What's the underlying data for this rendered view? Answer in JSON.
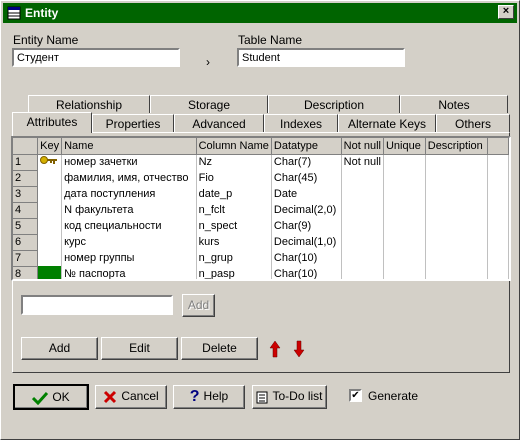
{
  "window": {
    "title": "Entity",
    "close_glyph": "×"
  },
  "entity_name": {
    "label": "Entity Name",
    "value": "Студент"
  },
  "table_name": {
    "label": "Table Name",
    "value": "Student"
  },
  "arrow_glyph": "›",
  "tabs_row1": [
    "Relationship",
    "Storage",
    "Description",
    "Notes"
  ],
  "tabs_row2": [
    "Attributes",
    "Properties",
    "Advanced",
    "Indexes",
    "Alternate Keys",
    "Others"
  ],
  "grid": {
    "headers": [
      "Key",
      "Name",
      "Column Name",
      "Datatype",
      "Not null",
      "Unique",
      "Description"
    ],
    "rows": [
      {
        "num": "1",
        "name": "номер зачетки",
        "column": "Nz",
        "datatype": "Char(7)",
        "notnull": "Not null",
        "unique": "",
        "desc": ""
      },
      {
        "num": "2",
        "name": "фамилия, имя, отчество",
        "column": "Fio",
        "datatype": "Char(45)",
        "notnull": "",
        "unique": "",
        "desc": ""
      },
      {
        "num": "3",
        "name": "дата поступления",
        "column": "date_p",
        "datatype": "Date",
        "notnull": "",
        "unique": "",
        "desc": ""
      },
      {
        "num": "4",
        "name": "N факультета",
        "column": "n_fclt",
        "datatype": "Decimal(2,0)",
        "notnull": "",
        "unique": "",
        "desc": ""
      },
      {
        "num": "5",
        "name": "код специальности",
        "column": "n_spect",
        "datatype": "Char(9)",
        "notnull": "",
        "unique": "",
        "desc": ""
      },
      {
        "num": "6",
        "name": "курс",
        "column": "kurs",
        "datatype": "Decimal(1,0)",
        "notnull": "",
        "unique": "",
        "desc": ""
      },
      {
        "num": "7",
        "name": "номер группы",
        "column": "n_grup",
        "datatype": "Char(10)",
        "notnull": "",
        "unique": "",
        "desc": ""
      },
      {
        "num": "8",
        "name": "№ паспорта",
        "column": "n_pasp",
        "datatype": "Char(10)",
        "notnull": "",
        "unique": "",
        "desc": ""
      }
    ]
  },
  "new_attribute": {
    "value": "",
    "add_label": "Add"
  },
  "actions": {
    "add": "Add",
    "edit": "Edit",
    "delete": "Delete"
  },
  "footer": {
    "ok": "OK",
    "cancel": "Cancel",
    "help": "Help",
    "todo": "To-Do list",
    "generate": "Generate",
    "generate_checked": "✔"
  },
  "colors": {
    "titlebar": "#006400",
    "key_green": "#008000",
    "arrow_red": "#cc0000"
  }
}
